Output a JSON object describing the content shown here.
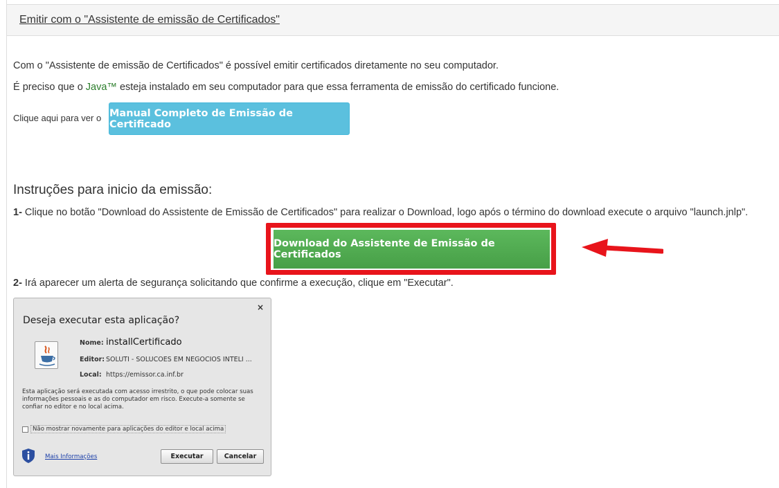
{
  "panel": {
    "title": "Emitir com o \"Assistente de emissão de Certificados\""
  },
  "intro": {
    "line1": "Com o \"Assistente de emissão de Certificados\" é possível emitir certificados diretamente no seu computador.",
    "line2_prefix": "É preciso que o ",
    "line2_link": "Java™",
    "line2_suffix": " esteja instalado em seu computador para que essa ferramenta de emissão do certificado funcione."
  },
  "manual": {
    "label": "Clique aqui para ver o",
    "button_label": "Manual Completo de Emissão de Certificado"
  },
  "instructions": {
    "heading": "Instruções para inicio da emissão:",
    "step1_num": "1-",
    "step1_text": " Clique no botão \"Download do Assistente de Emissão de Certificados\" para realizar o Download, logo após o término do download execute o arquivo \"launch.jnlp\".",
    "download_button_label": "Download do Assistente de Emissão de Certificados",
    "step2_num": "2-",
    "step2_text": " Irá aparecer um alerta de segurança solicitando que confirme a execução, clique em \"Executar\"."
  },
  "dialog": {
    "close": "×",
    "title": "Deseja executar esta aplicação?",
    "name_label": "Nome:",
    "name_value": "installCertificado",
    "editor_label": "Editor:",
    "editor_value": "SOLUTI - SOLUCOES EM NEGOCIOS INTELI ...",
    "local_label": "Local:",
    "local_value": "https://emissor.ca.inf.br",
    "warning": "Esta aplicação será executada com acesso irrestrito, o que pode colocar suas informações pessoais e as do computador em risco. Execute-a somente se confiar no editor e no local acima.",
    "checkbox_label": "Não mostrar novamente para aplicações do editor e local acima",
    "more_info": "Mais Informações",
    "execute_button": "Executar",
    "cancel_button": "Cancelar"
  },
  "colors": {
    "info_button": "#5bc0de",
    "success_button": "#5cb85c",
    "highlight": "#e8141b",
    "java_link": "#2a7d2a"
  }
}
